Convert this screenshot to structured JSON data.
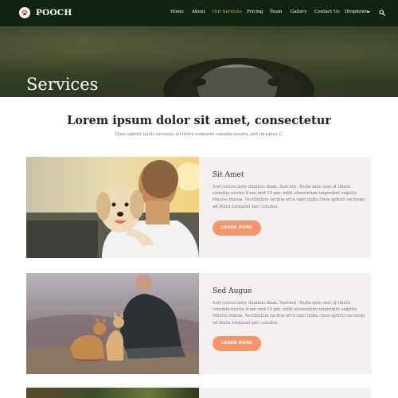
{
  "nav": {
    "brand": "POOCH",
    "items": [
      {
        "label": "Home"
      },
      {
        "label": "About"
      },
      {
        "label": "Our Services",
        "active": true
      },
      {
        "label": "Pricing"
      },
      {
        "label": "Team"
      },
      {
        "label": "Gallery"
      },
      {
        "label": "Contact Us"
      },
      {
        "label": "Dropdown"
      }
    ],
    "accent_color": "#e5b041",
    "icons": [
      "paw-icon",
      "chevron-down-icon",
      "search-icon"
    ]
  },
  "hero": {
    "title": "Services"
  },
  "intro": {
    "heading": "Lorem ipsum dolor sit amet, consectetur",
    "subtext": "Class aptent taciti sociosqu ad litora torquent conubia nostra, per inceptos C."
  },
  "services": [
    {
      "title": "Sit Amet",
      "text": "Sed cursus ante dapibus diam. Sed nisi. Nulla quis sem at libero conubia nostra 9 am and 10 pm. nibh elementum imperdiet sagittis Mauris massa. Vestibulum lacinia arcu eget nulla class aptent sociosqu ad litora torquent per conubia.",
      "button": "LEARN MORE"
    },
    {
      "title": "Sed Augue",
      "text": "Sed cursus ante dapibus diam. Sed nisi. Nulla quis sem at libero conubia nostra 9 am and 10 pm. nibh elementum imperdiet sagittis Mauris massa. Vestibulum lacinia arcu eget nulla class aptent sociosqu ad litora torquent per conubia.",
      "button": "LEARN MORE"
    }
  ],
  "colors": {
    "nav_bg": "#0f2410",
    "button": "#f6956a",
    "card_bg": "#f3f0ef"
  }
}
